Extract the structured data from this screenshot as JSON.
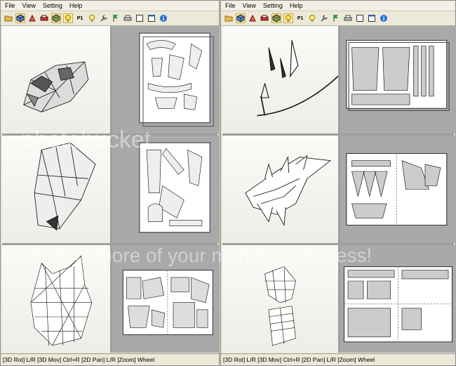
{
  "menu": {
    "file": "File",
    "view": "View",
    "setting": "Setting",
    "help": "Help"
  },
  "toolbar": {
    "icons": [
      "open-icon",
      "cube-icon",
      "unfold-icon",
      "print-preview-icon",
      "cube-view-icon",
      "bulb-icon",
      "page-icon",
      "bulb2-icon",
      "wrench-icon",
      "flag-icon",
      "printer-icon",
      "window-icon",
      "window2-icon",
      "info-icon"
    ],
    "page_label": "P1"
  },
  "status": {
    "text": "[3D Rot] L/R [3D Mov] Ctrl+R [2D Pan] L/R [Zoom] Wheel"
  },
  "watermark": {
    "line1": "photobucket",
    "line2": "Protect more of your memories for less!"
  },
  "colors": {
    "pressed_bg": "#ffe9a6",
    "window_bg": "#ece9d8"
  }
}
